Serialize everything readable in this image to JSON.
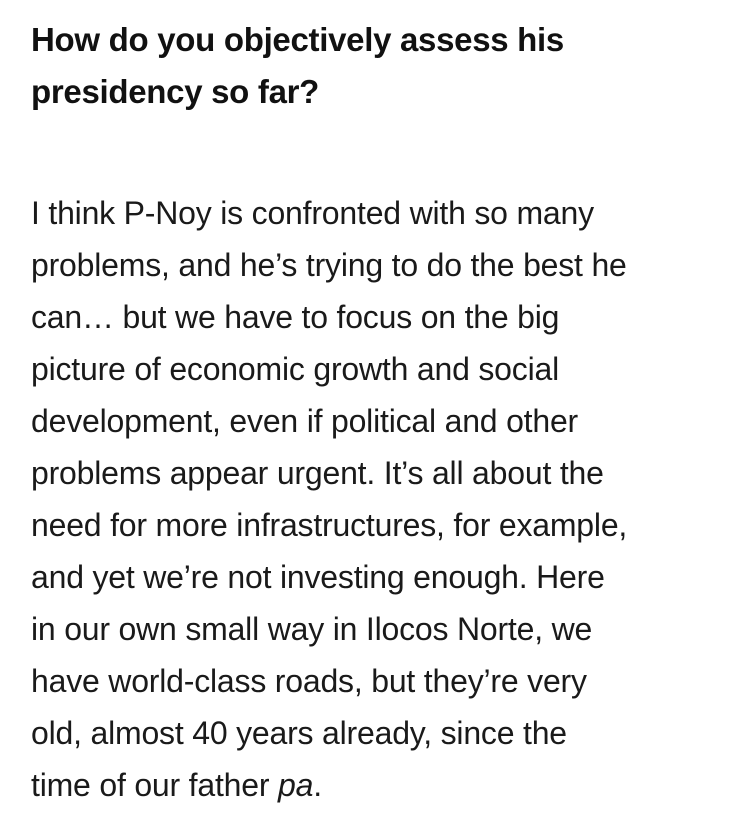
{
  "article": {
    "question_lines": [
      "How do you objectively assess his",
      "presidency so far?"
    ],
    "answer_lines": [
      "I think P-Noy is confronted with so many",
      "problems, and he’s trying to do the best he",
      "can… but we have to focus on the big",
      "picture of economic growth and social",
      "development, even if political and other",
      "problems appear urgent. It’s all about the",
      "need for more infrastructures, for example,",
      "and yet we’re not investing enough. Here",
      "in our own small way in Ilocos Norte, we",
      "have world-class roads, but they’re very",
      "old, almost 40 years already, since the"
    ],
    "answer_last_line_prefix": "time of our father ",
    "answer_last_line_italic": "pa",
    "answer_last_line_suffix": "."
  }
}
